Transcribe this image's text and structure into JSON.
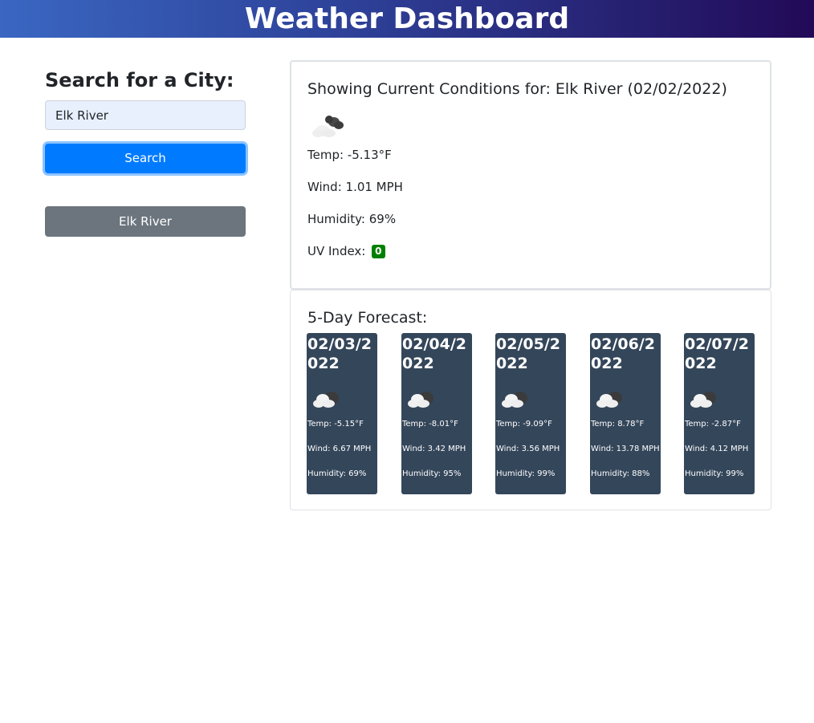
{
  "header": {
    "title": "Weather Dashboard"
  },
  "sidebar": {
    "heading": "Search for a City:",
    "search_value": "Elk River",
    "search_button_label": "Search",
    "history": [
      {
        "label": "Elk River"
      }
    ]
  },
  "current": {
    "title": "Showing Current Conditions for: Elk River (02/02/2022)",
    "icon": "cloud-icon",
    "temp": "Temp: -5.13°F",
    "wind": "Wind: 1.01 MPH",
    "humidity": "Humidity: 69%",
    "uv_label": "UV Index:",
    "uv_value": "0",
    "uv_color": "#008000"
  },
  "forecast": {
    "title": "5-Day Forecast:",
    "card_color": "#34465a",
    "days": [
      {
        "date": "02/03/2022",
        "icon": "cloud-icon",
        "temp": "Temp: -5.15°F",
        "wind": "Wind: 6.67 MPH",
        "humidity": "Humidity: 69%"
      },
      {
        "date": "02/04/2022",
        "icon": "cloud-icon",
        "temp": "Temp: -8.01°F",
        "wind": "Wind: 3.42 MPH",
        "humidity": "Humidity: 95%"
      },
      {
        "date": "02/05/2022",
        "icon": "cloud-icon",
        "temp": "Temp: -9.09°F",
        "wind": "Wind: 3.56 MPH",
        "humidity": "Humidity: 99%"
      },
      {
        "date": "02/06/2022",
        "icon": "cloud-icon",
        "temp": "Temp: 8.78°F",
        "wind": "Wind: 13.78 MPH",
        "humidity": "Humidity: 88%"
      },
      {
        "date": "02/07/2022",
        "icon": "cloud-icon",
        "temp": "Temp: -2.87°F",
        "wind": "Wind: 4.12 MPH",
        "humidity": "Humidity: 99%"
      }
    ]
  }
}
